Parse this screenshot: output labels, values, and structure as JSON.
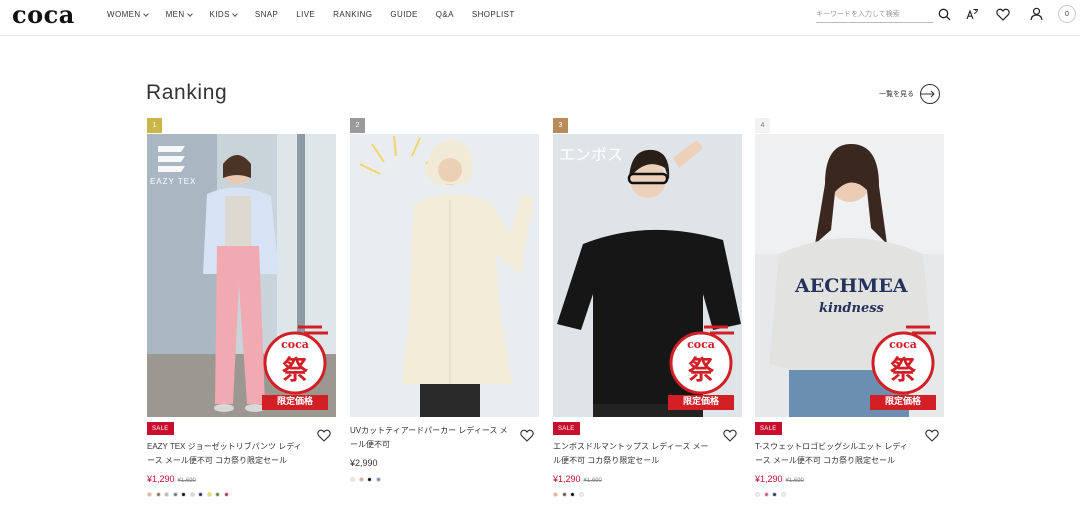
{
  "header": {
    "logo": "coca",
    "nav": [
      {
        "label": "WOMEN",
        "dropdown": true
      },
      {
        "label": "MEN",
        "dropdown": true
      },
      {
        "label": "KIDS",
        "dropdown": true
      },
      {
        "label": "SNAP",
        "dropdown": false
      },
      {
        "label": "LIVE",
        "dropdown": false
      },
      {
        "label": "RANKING",
        "dropdown": false
      },
      {
        "label": "GUIDE",
        "dropdown": false
      },
      {
        "label": "Q&A",
        "dropdown": false
      },
      {
        "label": "SHOPLIST",
        "dropdown": false
      }
    ],
    "search_placeholder": "キーワードを入力して検索",
    "icons": [
      "search-icon",
      "translate-icon",
      "heart-icon",
      "user-icon"
    ],
    "cart_count": "0"
  },
  "section": {
    "title": "Ranking",
    "view_all": "一覧を見る"
  },
  "products": [
    {
      "rank": "1",
      "rank_color": "#c9b54a",
      "sale": "SALE",
      "name": "EAZY TEX ジョーゼットリブパンツ レディース メール便不可 コカ祭り限定セール",
      "price": "¥1,290",
      "old_price": "¥1,690",
      "is_sale": true,
      "has_stamp": true,
      "stamp_text": "限定価格",
      "stamp_brand": "coca",
      "brand_overlay": "EAZY TEX",
      "swatches": [
        "#e8b08a",
        "#8a7a6a",
        "#b7b7b7",
        "#6d7a80",
        "#111111",
        "#d8d8d8",
        "#2a2a6a",
        "#e8e04a",
        "#6a8a3a",
        "#c23a4a"
      ]
    },
    {
      "rank": "2",
      "rank_color": "#9a9a9a",
      "sale": "",
      "name": "UVカットティアードパーカー レディース メール便不可",
      "price": "¥2,990",
      "old_price": "",
      "is_sale": false,
      "has_stamp": false,
      "swatches": [
        "#f0ead8",
        "#e8a888",
        "#111111",
        "#6a8ad8"
      ]
    },
    {
      "rank": "3",
      "rank_color": "#b98a5a",
      "sale": "SALE",
      "name": "エンボスドルマントップス レディース メール便不可 コカ祭り限定セール",
      "price": "¥1,290",
      "old_price": "¥1,690",
      "is_sale": true,
      "has_stamp": true,
      "stamp_text": "限定価格",
      "stamp_brand": "coca",
      "overlay_text": "エンボス",
      "swatches": [
        "#e8b08a",
        "#6a5a4a",
        "#111111",
        "#eeeeee"
      ]
    },
    {
      "rank": "4",
      "rank_color": "#f2f2f2",
      "sale": "SALE",
      "name": "T-スウェットロゴビッグシルエット レディース メール便不可 コカ祭り限定セール",
      "price": "¥1,290",
      "old_price": "¥1,690",
      "is_sale": true,
      "has_stamp": true,
      "stamp_text": "限定価格",
      "stamp_brand": "coca",
      "sweat_logo_1": "AECHMEA",
      "sweat_logo_2": "kindness",
      "swatches": [
        "#eeeeee",
        "#d85a8a",
        "#2a3a6a",
        "#eeeeee"
      ]
    }
  ]
}
